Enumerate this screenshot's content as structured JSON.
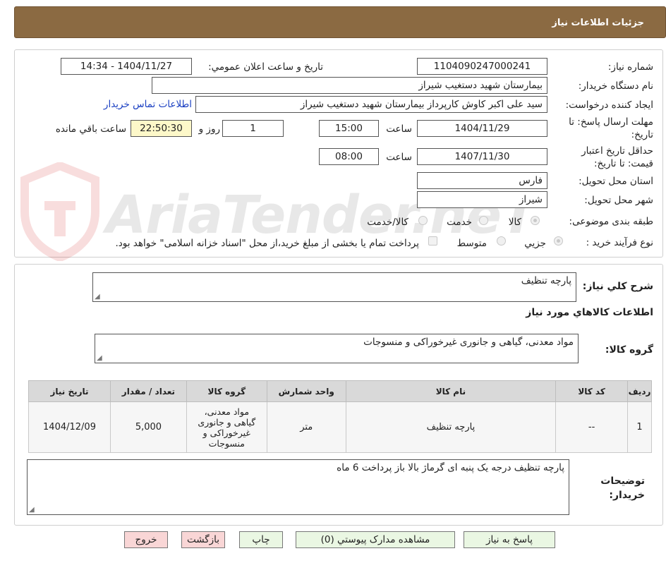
{
  "header": {
    "title": "جزئیات اطلاعات نیاز"
  },
  "form": {
    "need_number_label": "شماره نیاز:",
    "need_number": "1104090247000241",
    "announce_label": "تاریخ و ساعت اعلان عمومي:",
    "announce_value": "1404/11/27 - 14:34",
    "buyer_org_label": "نام دستگاه خریدار:",
    "buyer_org": "بیمارستان شهید دستغیب شیراز",
    "creator_label": "ایجاد کننده درخواست:",
    "creator": "سید علی اکبر کاوش کارپرداز بیمارستان شهید دستغیب شیراز",
    "contact_link": "اطلاعات تماس خریدار",
    "deadline_label": "مهلت ارسال پاسخ: تا تاریخ:",
    "deadline_date": "1404/11/29",
    "time_label": "ساعت",
    "deadline_time": "15:00",
    "days_value": "1",
    "days_label": "روز و",
    "remaining_time": "22:50:30",
    "remaining_label": "ساعت باقي مانده",
    "validity_label": "حداقل تاریخ اعتبار قیمت: تا تاریخ:",
    "validity_date": "1407/11/30",
    "validity_time": "08:00",
    "province_label": "استان محل تحویل:",
    "province": "فارس",
    "city_label": "شهر محل تحویل:",
    "city": "شیراز",
    "category_label": "طبقه بندی موضوعی:",
    "category_options": [
      "کالا",
      "خدمت",
      "کالا/خدمت"
    ],
    "process_label": "نوع فرآیند خرید :",
    "process_options": [
      "جزیي",
      "متوسط"
    ],
    "payment_note": "پرداخت تمام یا بخشی از مبلغ خرید،از محل \"اسناد خزانه اسلامی\" خواهد بود."
  },
  "details": {
    "summary_label": "شرح کلي نیاز:",
    "summary": "پارچه تنظیف",
    "goods_info_title": "اطلاعات کالاهاي مورد نیاز",
    "group_label": "گروه کالا:",
    "group": "مواد معدنی، گیاهی و جانوری غیرخوراکی و منسوجات",
    "table_headers": [
      "ردیف",
      "کد کالا",
      "نام کالا",
      "واحد شمارش",
      "گروه کالا",
      "تعداد / مقدار",
      "تاریخ نیاز"
    ],
    "rows": [
      {
        "index": "1",
        "code": "--",
        "name": "پارچه تنظیف",
        "unit": "متر",
        "group": "مواد معدنی، گیاهی و جانوری غیرخوراکی و منسوجات",
        "quantity": "5,000",
        "date": "1404/12/09"
      }
    ],
    "buyer_notes_label": "توضیحات خریدار:",
    "buyer_notes": "پارچه تنظیف درجه یک پنبه ای گرماژ بالا باز پرداخت 6 ماه"
  },
  "buttons": {
    "reply": "پاسخ به نیاز",
    "attachments": "مشاهده مدارک پیوستي (0)",
    "print": "چاپ",
    "back": "بازگشت",
    "exit": "خروج"
  },
  "watermark": "AriaTender.neT",
  "colors": {
    "header": "#8b6a42",
    "button_green": "#eaf7e3",
    "button_pink": "#f9d6d6",
    "highlight": "#fdf8c9",
    "link": "#1a3fc2"
  }
}
